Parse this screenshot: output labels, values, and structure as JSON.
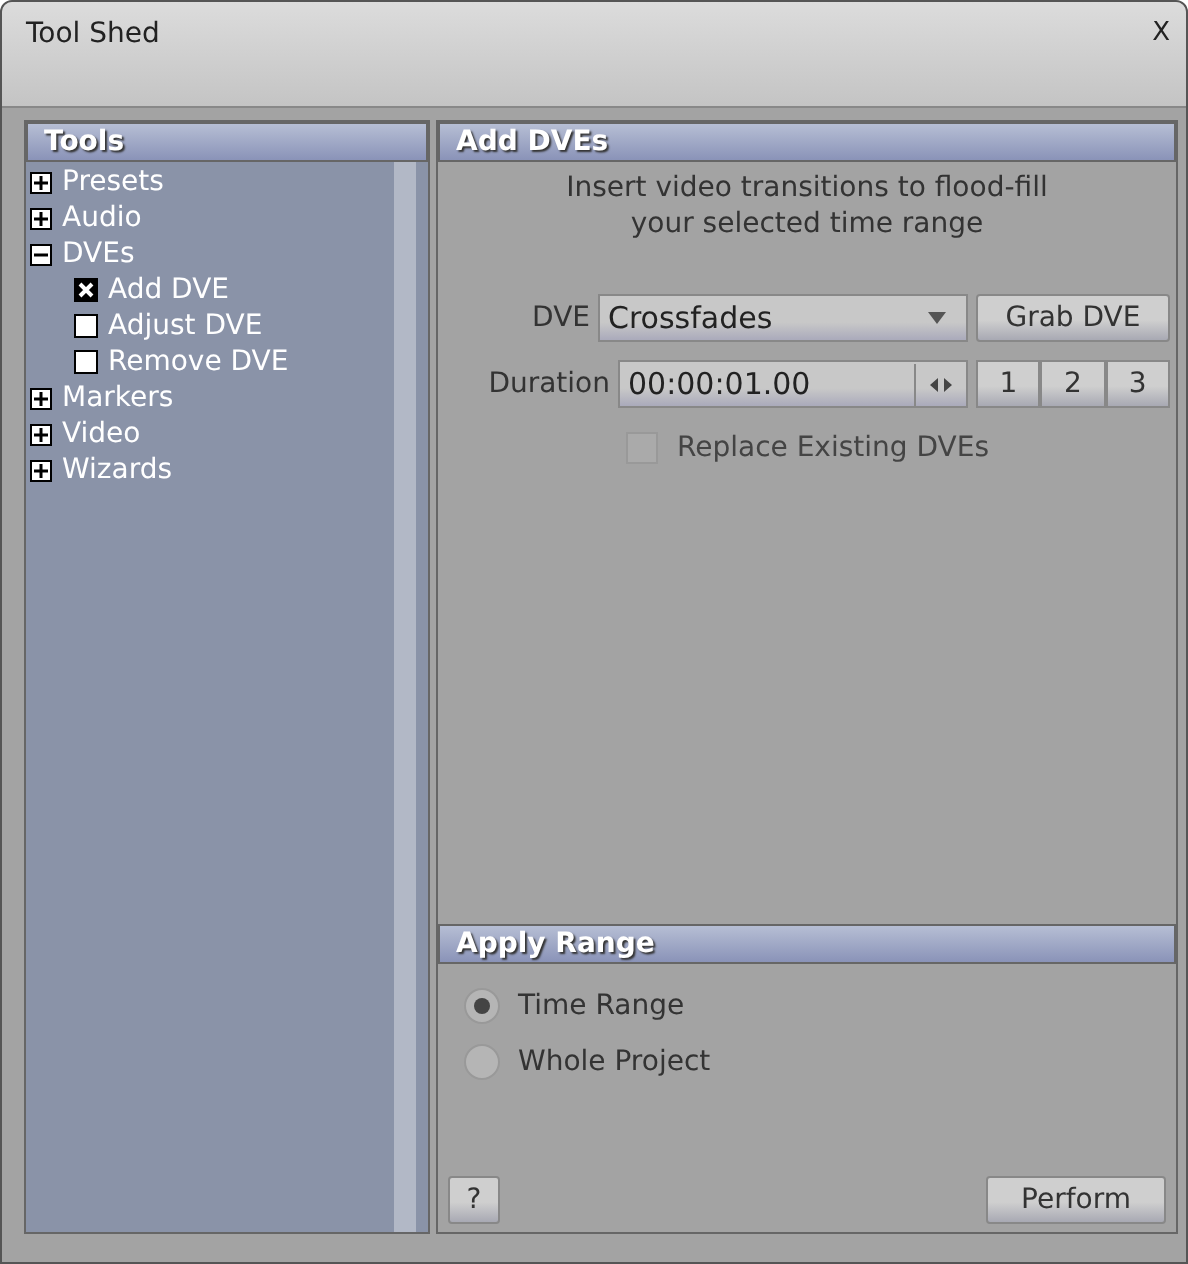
{
  "window": {
    "title": "Tool Shed",
    "close": "X"
  },
  "tools": {
    "title": "Tools",
    "items": [
      {
        "label": "Presets",
        "expanded": false
      },
      {
        "label": "Audio",
        "expanded": false
      },
      {
        "label": "DVEs",
        "expanded": true,
        "children": [
          {
            "label": "Add DVE",
            "checked": true
          },
          {
            "label": "Adjust DVE",
            "checked": false
          },
          {
            "label": "Remove DVE",
            "checked": false
          }
        ]
      },
      {
        "label": "Markers",
        "expanded": false
      },
      {
        "label": "Video",
        "expanded": false
      },
      {
        "label": "Wizards",
        "expanded": false
      }
    ]
  },
  "add_dves": {
    "title": "Add DVEs",
    "description": "Insert video transitions to flood-fill\nyour selected time range",
    "dve_label": "DVE",
    "dve_value": "Crossfades",
    "grab_button": "Grab DVE",
    "duration_label": "Duration",
    "duration_value": "00:00:01.00",
    "presets": [
      "1",
      "2",
      "3"
    ],
    "replace": {
      "label": "Replace Existing DVEs",
      "checked": false,
      "disabled": true
    }
  },
  "apply_range": {
    "title": "Apply Range",
    "options": [
      {
        "label": "Time Range",
        "selected": true
      },
      {
        "label": "Whole Project",
        "selected": false
      }
    ]
  },
  "help_button": "?",
  "perform_button": "Perform"
}
